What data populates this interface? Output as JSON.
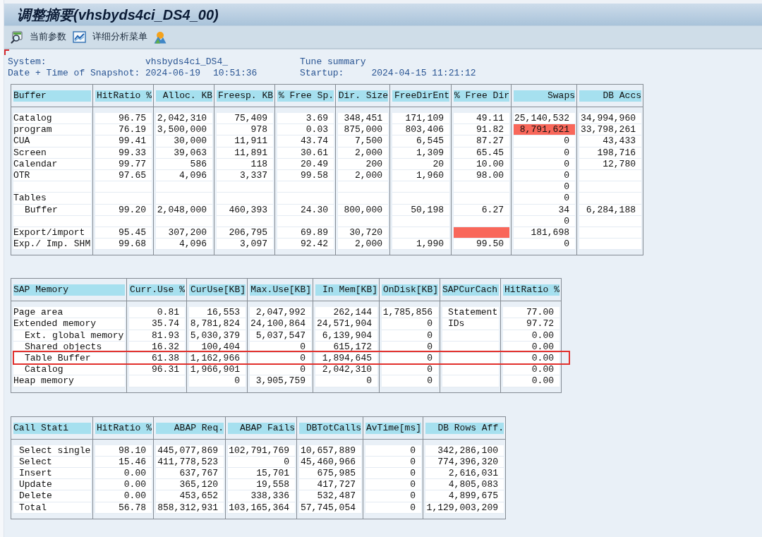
{
  "window": {
    "title": "调整摘要(vhsbyds4ci_DS4_00)"
  },
  "toolbar": {
    "buttons": [
      {
        "label": "当前参数"
      },
      {
        "label": "详细分析菜单"
      }
    ]
  },
  "snapshot_info": {
    "system_label": "System:",
    "system": "vhsbyds4ci_DS4_",
    "report_title": "Tune summary",
    "snapshot_label": "Date + Time of Snapshot:",
    "snapshot_date": "2024-06-19",
    "snapshot_time": "10:51:36",
    "startup_label": "Startup:",
    "startup": "2024-04-15 11:21:12"
  },
  "buffer_table": {
    "columns": [
      {
        "label": "Buffer",
        "kind": "label"
      },
      {
        "label": "HitRatio %",
        "kind": "number"
      },
      {
        "label": "Alloc. KB",
        "kind": "number"
      },
      {
        "label": "Freesp. KB",
        "kind": "number"
      },
      {
        "label": "% Free Sp.",
        "kind": "number"
      },
      {
        "label": "Dir. Size",
        "kind": "number"
      },
      {
        "label": "FreeDirEnt",
        "kind": "number"
      },
      {
        "label": "% Free Dir",
        "kind": "number"
      },
      {
        "label": "Swaps",
        "kind": "number"
      },
      {
        "label": "DB Accs",
        "kind": "number"
      }
    ],
    "rows": [
      {
        "cells": [
          {
            "text": "Catalog",
            "alert": false
          },
          {
            "text": "96.75",
            "alert": false
          },
          {
            "text": "2,042,310",
            "alert": false
          },
          {
            "text": "75,409",
            "alert": false
          },
          {
            "text": "3.69",
            "alert": false
          },
          {
            "text": "348,451",
            "alert": false
          },
          {
            "text": "171,109",
            "alert": false
          },
          {
            "text": "49.11",
            "alert": false
          },
          {
            "text": "25,140,532",
            "alert": false
          },
          {
            "text": "34,994,960",
            "alert": false
          }
        ]
      },
      {
        "cells": [
          {
            "text": "program",
            "alert": false
          },
          {
            "text": "76.19",
            "alert": false
          },
          {
            "text": "3,500,000",
            "alert": false
          },
          {
            "text": "978",
            "alert": false
          },
          {
            "text": "0.03",
            "alert": false
          },
          {
            "text": "875,000",
            "alert": false
          },
          {
            "text": "803,406",
            "alert": false
          },
          {
            "text": "91.82",
            "alert": false
          },
          {
            "text": "8,791,621",
            "alert": true
          },
          {
            "text": "33,798,261",
            "alert": false
          }
        ]
      },
      {
        "cells": [
          {
            "text": "CUA",
            "alert": false
          },
          {
            "text": "99.41",
            "alert": false
          },
          {
            "text": "30,000",
            "alert": false
          },
          {
            "text": "11,911",
            "alert": false
          },
          {
            "text": "43.74",
            "alert": false
          },
          {
            "text": "7,500",
            "alert": false
          },
          {
            "text": "6,545",
            "alert": false
          },
          {
            "text": "87.27",
            "alert": false
          },
          {
            "text": "0",
            "alert": false
          },
          {
            "text": "43,433",
            "alert": false
          }
        ]
      },
      {
        "cells": [
          {
            "text": "Screen",
            "alert": false
          },
          {
            "text": "99.33",
            "alert": false
          },
          {
            "text": "39,063",
            "alert": false
          },
          {
            "text": "11,891",
            "alert": false
          },
          {
            "text": "30.61",
            "alert": false
          },
          {
            "text": "2,000",
            "alert": false
          },
          {
            "text": "1,309",
            "alert": false
          },
          {
            "text": "65.45",
            "alert": false
          },
          {
            "text": "0",
            "alert": false
          },
          {
            "text": "198,716",
            "alert": false
          }
        ]
      },
      {
        "cells": [
          {
            "text": "Calendar",
            "alert": false
          },
          {
            "text": "99.77",
            "alert": false
          },
          {
            "text": "586",
            "alert": false
          },
          {
            "text": "118",
            "alert": false
          },
          {
            "text": "20.49",
            "alert": false
          },
          {
            "text": "200",
            "alert": false
          },
          {
            "text": "20",
            "alert": false
          },
          {
            "text": "10.00",
            "alert": false
          },
          {
            "text": "0",
            "alert": false
          },
          {
            "text": "12,780",
            "alert": false
          }
        ]
      },
      {
        "cells": [
          {
            "text": "OTR",
            "alert": false
          },
          {
            "text": "97.65",
            "alert": false
          },
          {
            "text": "4,096",
            "alert": false
          },
          {
            "text": "3,337",
            "alert": false
          },
          {
            "text": "99.58",
            "alert": false
          },
          {
            "text": "2,000",
            "alert": false
          },
          {
            "text": "1,960",
            "alert": false
          },
          {
            "text": "98.00",
            "alert": false
          },
          {
            "text": "0",
            "alert": false
          },
          {
            "alert": false
          }
        ]
      },
      {
        "cells": [
          {
            "alert": false
          },
          {
            "alert": false
          },
          {
            "alert": false
          },
          {
            "alert": false
          },
          {
            "alert": false
          },
          {
            "alert": false
          },
          {
            "alert": false
          },
          {
            "alert": false
          },
          {
            "text": "0",
            "alert": false
          },
          {
            "alert": false
          }
        ]
      },
      {
        "cells": [
          {
            "text": "Tables",
            "alert": false
          },
          {
            "alert": false
          },
          {
            "alert": false
          },
          {
            "alert": false
          },
          {
            "alert": false
          },
          {
            "alert": false
          },
          {
            "alert": false
          },
          {
            "alert": false
          },
          {
            "text": "0",
            "alert": false
          },
          {
            "alert": false
          }
        ],
        "children": [
          {
            "cells": [
              {
                "text": "Buffer",
                "alert": false
              },
              {
                "text": "99.20",
                "alert": false
              },
              {
                "text": "2,048,000",
                "alert": false
              },
              {
                "text": "460,393",
                "alert": false
              },
              {
                "text": "24.30",
                "alert": false
              },
              {
                "text": "800,000",
                "alert": false
              },
              {
                "text": "50,198",
                "alert": false
              },
              {
                "text": "6.27",
                "alert": false
              },
              {
                "text": "34",
                "alert": false
              },
              {
                "text": "6,284,188",
                "alert": false
              }
            ]
          }
        ]
      },
      {
        "cells": [
          {
            "alert": false
          },
          {
            "alert": false
          },
          {
            "alert": false
          },
          {
            "alert": false
          },
          {
            "alert": false
          },
          {
            "alert": false
          },
          {
            "alert": false
          },
          {
            "alert": false
          },
          {
            "text": "0",
            "alert": false
          },
          {
            "alert": false
          }
        ]
      },
      {
        "cells": [
          {
            "text": "Export/import",
            "alert": false
          },
          {
            "text": "95.45",
            "alert": false
          },
          {
            "text": "307,200",
            "alert": false
          },
          {
            "text": "206,795",
            "alert": false
          },
          {
            "text": "69.89",
            "alert": false
          },
          {
            "text": "30,720",
            "alert": false
          },
          {
            "alert": false
          },
          {
            "alert": true
          },
          {
            "text": "181,698",
            "alert": false
          },
          {
            "alert": false
          }
        ]
      },
      {
        "cells": [
          {
            "text": "Exp./ Imp. SHM",
            "alert": false
          },
          {
            "text": "99.68",
            "alert": false
          },
          {
            "text": "4,096",
            "alert": false
          },
          {
            "text": "3,097",
            "alert": false
          },
          {
            "text": "92.42",
            "alert": false
          },
          {
            "text": "2,000",
            "alert": false
          },
          {
            "text": "1,990",
            "alert": false
          },
          {
            "text": "99.50",
            "alert": false
          },
          {
            "text": "0",
            "alert": false
          },
          {
            "alert": false
          }
        ]
      }
    ]
  },
  "sap_memory_table": {
    "columns": [
      {
        "label": "SAP Memory",
        "kind": "label"
      },
      {
        "label": "Curr.Use %",
        "kind": "number"
      },
      {
        "label": "CurUse[KB]",
        "kind": "number"
      },
      {
        "label": "Max.Use[KB]",
        "kind": "number"
      },
      {
        "label": "In Mem[KB]",
        "kind": "number"
      },
      {
        "label": "OnDisk[KB]",
        "kind": "number"
      },
      {
        "label": "SAPCurCach",
        "kind": "text"
      },
      {
        "label": "HitRatio %",
        "kind": "number"
      }
    ],
    "rows": [
      {
        "marked": false,
        "cells": [
          "Page area",
          "0.81",
          "16,553",
          "2,047,992",
          "262,144",
          "1,785,856",
          "Statement",
          "77.00"
        ]
      },
      {
        "marked": false,
        "cells": [
          "Extended memory",
          "35.74",
          "8,781,824",
          "24,100,864",
          "24,571,904",
          "0",
          "IDs",
          "97.72"
        ],
        "children": [
          {
            "marked": false,
            "cells": [
              "Ext. global memory",
              "81.93",
              "5,030,379",
              "5,037,547",
              "6,139,904",
              "0",
              null,
              "0.00"
            ]
          },
          {
            "marked": false,
            "cells": [
              "Shared objects",
              "16.32",
              "100,404",
              "0",
              "615,172",
              "0",
              null,
              "0.00"
            ]
          },
          {
            "marked": true,
            "cells": [
              "Table Buffer",
              "61.38",
              "1,162,966",
              "0",
              "1,894,645",
              "0",
              null,
              "0.00"
            ]
          },
          {
            "marked": false,
            "cells": [
              "Catalog",
              "96.31",
              "1,966,901",
              "0",
              "2,042,310",
              "0",
              null,
              "0.00"
            ]
          }
        ]
      },
      {
        "marked": false,
        "cells": [
          "Heap memory",
          null,
          "0",
          "3,905,759",
          "0",
          "0",
          null,
          "0.00"
        ]
      }
    ]
  },
  "call_statistics_table": {
    "columns": [
      {
        "label": "Call Stati",
        "kind": "text"
      },
      {
        "label": "HitRatio %",
        "kind": "number"
      },
      {
        "label": "ABAP Req.",
        "kind": "number"
      },
      {
        "label": "ABAP Fails",
        "kind": "number"
      },
      {
        "label": "DBTotCalls",
        "kind": "number"
      },
      {
        "label": "AvTime[ms]",
        "kind": "number"
      },
      {
        "label": "DB Rows Aff.",
        "kind": "number"
      }
    ],
    "rows": [
      {
        "cells": [
          "Select single",
          "98.10",
          "445,077,869",
          "102,791,769",
          "10,657,889",
          "0",
          "342,286,100"
        ]
      },
      {
        "cells": [
          "Select",
          "15.46",
          "411,778,523",
          "0",
          "45,460,966",
          "0",
          "774,396,320"
        ]
      },
      {
        "cells": [
          "Insert",
          "0.00",
          "637,767",
          "15,701",
          "675,985",
          "0",
          "2,616,031"
        ]
      },
      {
        "cells": [
          "Update",
          "0.00",
          "365,120",
          "19,558",
          "417,727",
          "0",
          "4,805,083"
        ]
      },
      {
        "cells": [
          "Delete",
          "0.00",
          "453,652",
          "338,336",
          "532,487",
          "0",
          "4,899,675"
        ]
      },
      {
        "cells": [
          "Total",
          "56.78",
          "858,312,931",
          "103,165,364",
          "57,745,054",
          "0",
          "1,129,003,209"
        ]
      }
    ]
  }
}
